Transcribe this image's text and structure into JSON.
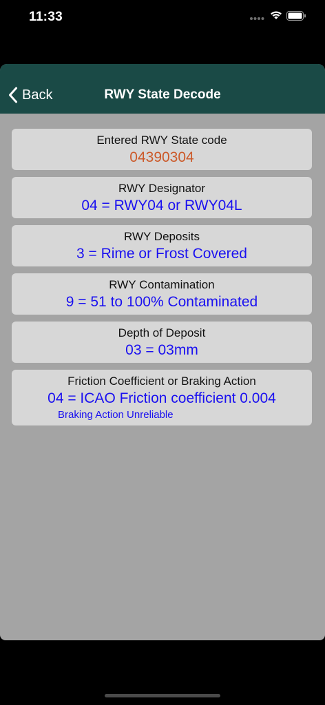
{
  "status_bar": {
    "time": "11:33"
  },
  "nav": {
    "back_label": "Back",
    "title": "RWY State Decode"
  },
  "cards": [
    {
      "title": "Entered RWY State code",
      "value": "04390304"
    },
    {
      "title": "RWY Designator",
      "value": "04 = RWY04 or RWY04L"
    },
    {
      "title": "RWY Deposits",
      "value": "3 = Rime or Frost Covered"
    },
    {
      "title": "RWY Contamination",
      "value": "9 = 51 to 100% Contaminated"
    },
    {
      "title": "Depth of Deposit",
      "value": "03 = 03mm"
    },
    {
      "title": "Friction Coefficient or Braking Action",
      "value": "04 = ICAO Friction coefficient 0.004",
      "sub": "Braking Action Unreliable"
    }
  ],
  "colors": {
    "nav_background": "#1a4a46",
    "sheet_background": "#a4a4a4",
    "card_background": "#d7d7d7",
    "value_blue": "#1a10f0",
    "code_orange": "#cc5a2a"
  },
  "icons": {
    "back": "chevron-left-icon",
    "signal": "cellular-signal-icon",
    "wifi": "wifi-icon",
    "battery": "battery-icon"
  }
}
